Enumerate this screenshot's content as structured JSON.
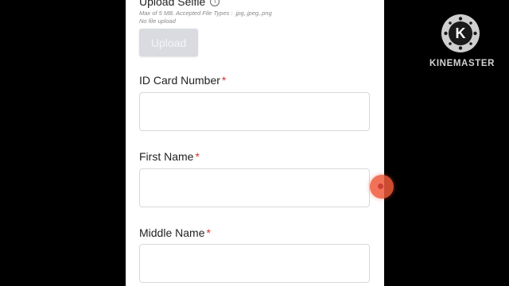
{
  "form": {
    "selfie_section": {
      "title": "Upload Selfie",
      "info_icon": "info-icon",
      "hint_types": "Max of 5 MB. Accepted File Types : .jpg,.jpeg,.png",
      "hint_status": "No file upload",
      "upload_label": "Upload"
    },
    "fields": {
      "id_card": {
        "label": "ID Card Number",
        "required_mark": "*",
        "value": ""
      },
      "first_name": {
        "label": "First Name",
        "required_mark": "*",
        "value": ""
      },
      "middle_name": {
        "label": "Middle Name",
        "required_mark": "*",
        "value": ""
      }
    }
  },
  "overlay": {
    "watermark_text": "KINEMASTER",
    "logo_letter": "K",
    "touch_indicator_color": "#f05a3a"
  },
  "colors": {
    "required": "#d0342c",
    "upload_button_bg": "#d9dbe0",
    "input_border": "#d6d8dc"
  }
}
